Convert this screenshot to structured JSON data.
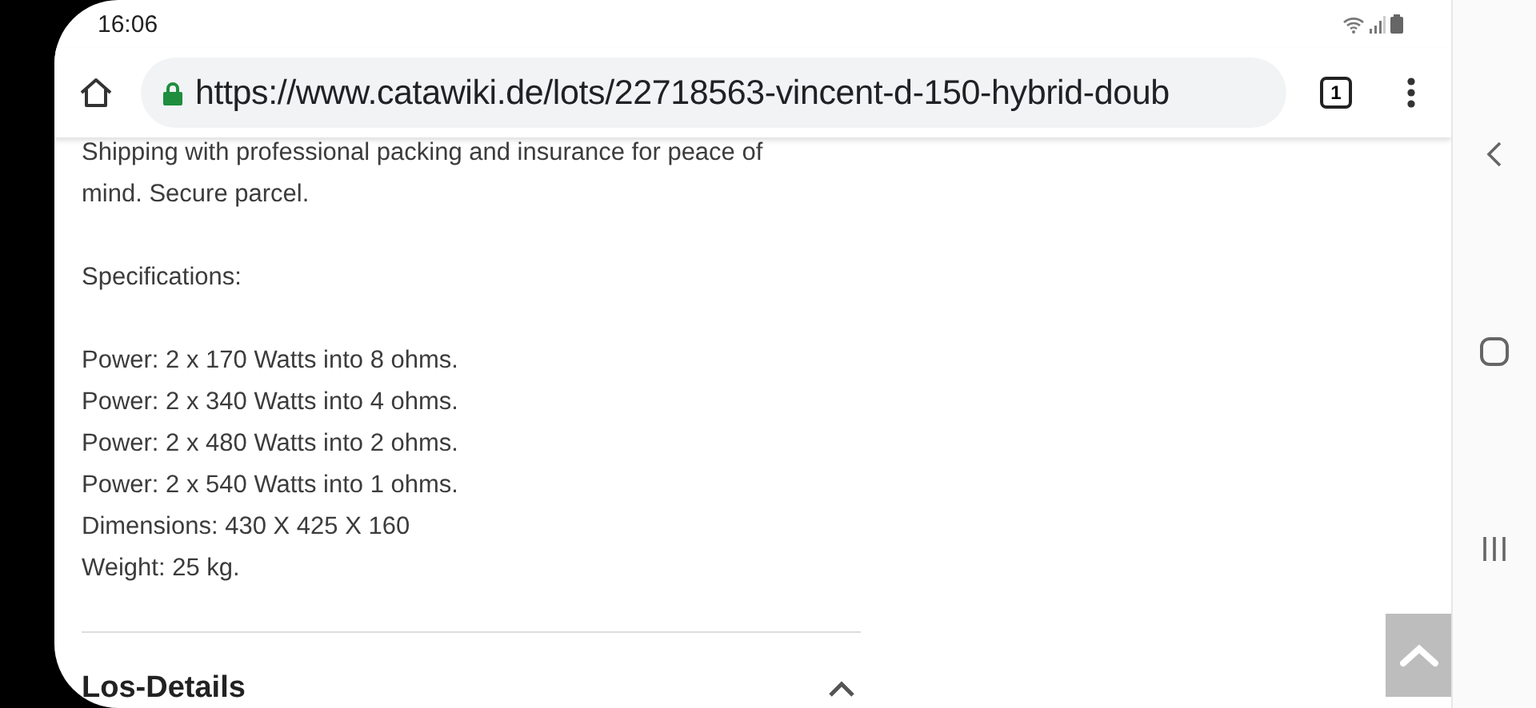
{
  "status_bar": {
    "time": "16:06"
  },
  "browser": {
    "url": "https://www.catawiki.de/lots/22718563-vincent-d-150-hybrid-doub",
    "tab_count": "1"
  },
  "description": [
    {
      "lines": [
        "Shipping with professional packing and insurance for peace of",
        "mind. Secure parcel."
      ]
    },
    {
      "lines": [
        "Specifications:"
      ]
    },
    {
      "lines": [
        "Power: 2 x 170 Watts into 8 ohms.",
        "Power: 2 x 340 Watts into 4 ohms.",
        "Power: 2 x 480 Watts into 2 ohms.",
        "Power: 2 x 540 Watts into 1 ohms.",
        "Dimensions: 430 X 425 X 160",
        "Weight: 25 kg."
      ]
    }
  ],
  "section": {
    "title": "Los-Details",
    "expanded": true
  }
}
